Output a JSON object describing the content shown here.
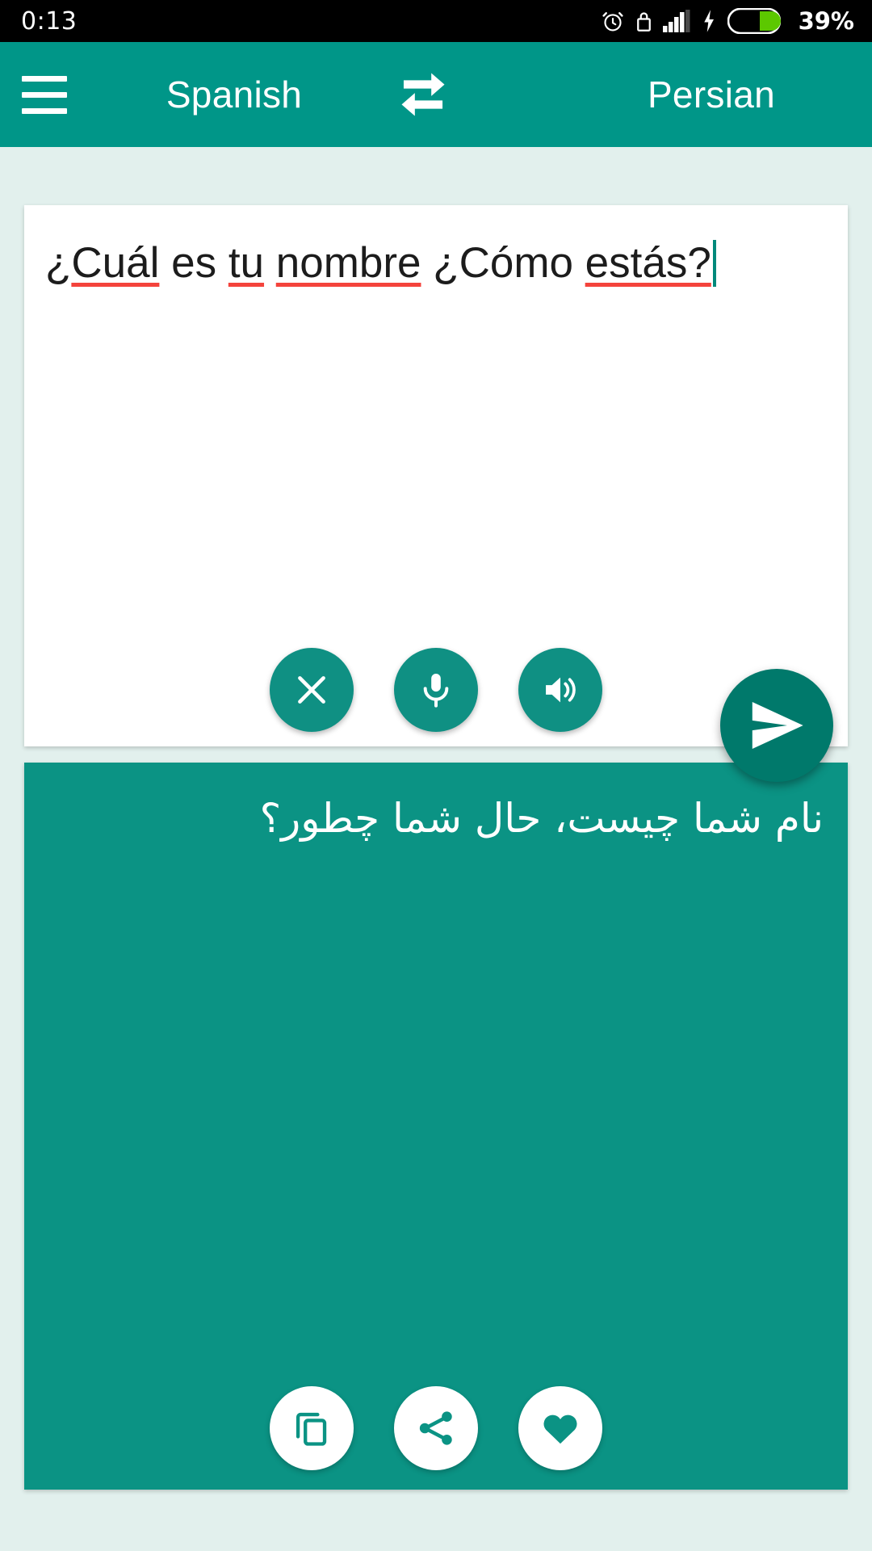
{
  "status_bar": {
    "time": "0:13",
    "battery_percent": "39%",
    "icons": [
      "alarm-icon",
      "lock-icon",
      "signal-icon",
      "charging-bolt-icon",
      "battery-icon"
    ]
  },
  "header": {
    "menu_icon": "hamburger-menu-icon",
    "source_language": "Spanish",
    "swap_icon": "swap-languages-icon",
    "target_language": "Persian",
    "background_color": "#009688"
  },
  "input_card": {
    "text_segments": [
      {
        "text": "¿",
        "misspelled": false
      },
      {
        "text": "Cuál",
        "misspelled": true
      },
      {
        "text": " es ",
        "misspelled": false
      },
      {
        "text": "tu",
        "misspelled": true
      },
      {
        "text": " ",
        "misspelled": false
      },
      {
        "text": "nombre",
        "misspelled": true
      },
      {
        "text": " ¿Cómo ",
        "misspelled": false
      },
      {
        "text": "estás?",
        "misspelled": true
      }
    ],
    "full_text": "¿Cuál es tu nombre ¿Cómo estás?",
    "spellcheck_color": "#f4433c",
    "cursor_visible": true,
    "actions": [
      {
        "name": "clear-button",
        "icon": "close-icon"
      },
      {
        "name": "microphone-button",
        "icon": "microphone-icon"
      },
      {
        "name": "speak-source-button",
        "icon": "speaker-icon"
      }
    ]
  },
  "send_button": {
    "name": "translate-send-button",
    "icon": "send-icon",
    "color": "#00796b"
  },
  "output_card": {
    "translated_text": "نام شما چیست، حال شما چطور؟",
    "background_color": "#0b9384",
    "actions": [
      {
        "name": "copy-button",
        "icon": "copy-icon"
      },
      {
        "name": "share-button",
        "icon": "share-icon"
      },
      {
        "name": "favorite-button",
        "icon": "heart-icon"
      }
    ]
  },
  "theme": {
    "page_background": "#e2f0ed",
    "accent": "#009688",
    "accent_dark": "#00796b"
  }
}
